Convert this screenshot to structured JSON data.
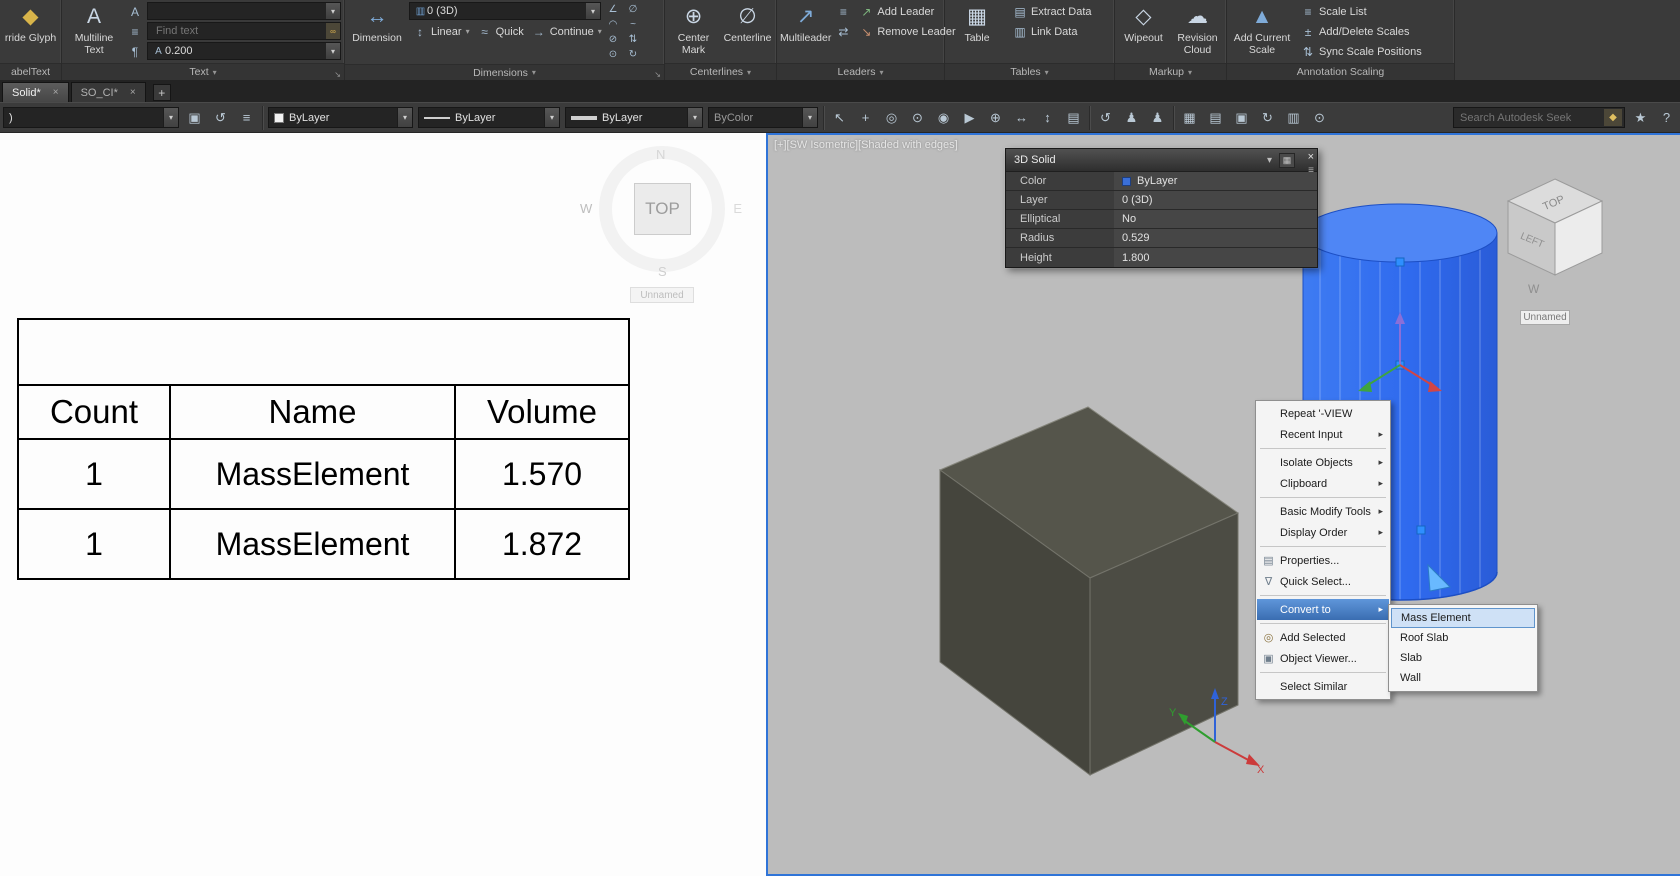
{
  "icons": {
    "dropdown_arrow": "▾",
    "submenu_arrow": "▸",
    "close": "×",
    "new_tab": "+",
    "panel_launcher": "↘",
    "help": "?",
    "communication_star": "★",
    "override_glyph": "◆",
    "multiline_text": "A",
    "text_style": "A",
    "text_justify": "≡",
    "text_annotative": "¶",
    "find_text": "∞",
    "text_height": "A",
    "dimension": "↔",
    "dim_style": "▥",
    "linear_dim": "↕",
    "quick_dim": "≈",
    "continue_dim": "→",
    "angular_dim": "∠",
    "diameter_dim": "∅",
    "arc_dim": "◠",
    "jog_dim": "~",
    "break_dim": "⊘",
    "adjust_space_dim": "⇅",
    "inspect_dim": "⊙",
    "update_dim": "↻",
    "center_mark": "⊕",
    "centerline": "∅",
    "multileader": "↗",
    "add_leader": "↗",
    "remove_leader": "↘",
    "align_leaders": "≡",
    "collect_leaders": "⇄",
    "table": "▦",
    "extract_data": "▤",
    "link_data": "▥",
    "wipeout": "◇",
    "revision_cloud": "☁",
    "add_current_scale": "▲",
    "scale_list": "≡",
    "add_delete_scales": "±",
    "sync_scale": "⇅",
    "make_layer_current": "▣",
    "layer_previous": "↺",
    "layer_states": "≡",
    "select": "↖",
    "pan": "+",
    "zoom": "◎",
    "orbit": "⊙",
    "steering_wheel": "◉",
    "show_motion": "▶",
    "measure": "↔",
    "match_properties": "▤",
    "globe": "⊕",
    "move": "↕",
    "undo": "↺",
    "redo": "↻",
    "group": "▣",
    "user": "♟",
    "layout_grid": "▦",
    "sheet": "▤",
    "refresh": "↻",
    "palette": "▥",
    "pin": "⊙",
    "seek": "◆",
    "customize": "▦",
    "palette_menu": "≡",
    "properties_menu": "▤",
    "quick_select_menu": "∇",
    "add_selected_menu": "◎",
    "object_viewer_menu": "▣"
  },
  "ribbon": {
    "clipped_panel": {
      "button_label": "rride Glyph",
      "panel_label": "abelText"
    },
    "text_panel": {
      "panel_label": "Text",
      "multiline_text_label": "Multiline Text",
      "style_combo_value": "",
      "find_placeholder": "Find text",
      "height_value": "0.200"
    },
    "dimensions_panel": {
      "panel_label": "Dimensions",
      "dimension_label": "Dimension",
      "style_combo_value": "0 (3D)",
      "linear_label": "Linear",
      "quick_label": "Quick",
      "continue_label": "Continue"
    },
    "centerlines_panel": {
      "panel_label": "Centerlines",
      "center_mark_label": "Center Mark",
      "centerline_label": "Centerline"
    },
    "leaders_panel": {
      "panel_label": "Leaders",
      "multileader_label": "Multileader",
      "add_leader_label": "Add Leader",
      "remove_leader_label": "Remove Leader"
    },
    "tables_panel": {
      "panel_label": "Tables",
      "table_label": "Table",
      "extract_data_label": "Extract Data",
      "link_data_label": "Link Data"
    },
    "markup_panel": {
      "panel_label": "Markup",
      "wipeout_label": "Wipeout",
      "revision_cloud_label": "Revision Cloud"
    },
    "annotation_scaling_panel": {
      "panel_label": "Annotation Scaling",
      "add_current_scale_label": "Add Current Scale",
      "scale_list_label": "Scale List",
      "add_delete_scales_label": "Add/Delete Scales",
      "sync_scale_positions_label": "Sync Scale Positions"
    }
  },
  "file_tabs": {
    "tab1": "Solid*",
    "tab2": "SO_CI*"
  },
  "toolbar": {
    "layer_combo_value": ")",
    "color_combo_value": "ByLayer",
    "linetype_combo_value": "ByLayer",
    "lineweight_combo_value": "ByLayer",
    "plotstyle_combo_value": "ByColor",
    "seek_placeholder": "Search Autodesk Seek"
  },
  "left_viewport": {
    "viewcube_face": "TOP",
    "compass": {
      "n": "N",
      "w": "W",
      "e": "E",
      "s": "S"
    },
    "view_name": "Unnamed",
    "table": {
      "col_headers": [
        "Count",
        "Name",
        "Volume"
      ],
      "rows": [
        [
          "1",
          "MassElement",
          "1.570"
        ],
        [
          "1",
          "MassElement",
          "1.872"
        ]
      ]
    }
  },
  "right_viewport": {
    "viewport_label": "[+][SW Isometric][Shaded with edges]",
    "viewcube_top": "TOP",
    "viewcube_left": "LEFT",
    "compass_w": "W",
    "view_name": "Unnamed",
    "ucs": {
      "x": "X",
      "y": "Y",
      "z": "Z"
    }
  },
  "quick_properties": {
    "title": "3D Solid",
    "rows": [
      {
        "label": "Color",
        "value": "ByLayer"
      },
      {
        "label": "Layer",
        "value": "0 (3D)"
      },
      {
        "label": "Elliptical",
        "value": "No"
      },
      {
        "label": "Radius",
        "value": "0.529"
      },
      {
        "label": "Height",
        "value": "1.800"
      }
    ]
  },
  "context_menu": {
    "repeat": "Repeat '-VIEW",
    "recent_input": "Recent Input",
    "isolate_objects": "Isolate Objects",
    "clipboard": "Clipboard",
    "basic_modify_tools": "Basic Modify Tools",
    "display_order": "Display Order",
    "properties": "Properties...",
    "quick_select": "Quick Select...",
    "convert_to": "Convert to",
    "add_selected": "Add Selected",
    "object_viewer": "Object Viewer...",
    "select_similar": "Select Similar"
  },
  "convert_submenu": {
    "mass_element": "Mass Element",
    "roof_slab": "Roof Slab",
    "slab": "Slab",
    "wall": "Wall"
  },
  "colors": {
    "solid_blue": "#2f6df0",
    "viewport_border": "#2f74d8",
    "menu_highlight": "#3a6db1",
    "selection_grip": "#2e8fff"
  }
}
